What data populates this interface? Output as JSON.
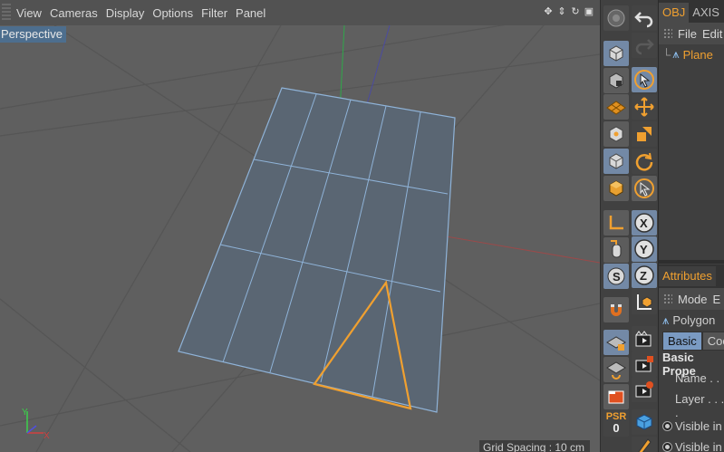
{
  "viewport": {
    "menu": [
      "View",
      "Cameras",
      "Display",
      "Options",
      "Filter",
      "Panel"
    ],
    "view_label": "Perspective",
    "grid_spacing": "Grid Spacing : 10 cm",
    "nav_icons": [
      "move-view-icon",
      "zoom-view-icon",
      "rotate-view-icon",
      "maximize-view-icon"
    ]
  },
  "toolbar_left": {
    "psr_label": "PSR",
    "psr_value": "0"
  },
  "object_manager": {
    "tabs": [
      "OBJ",
      "AXIS"
    ],
    "menu": [
      "File",
      "Edit"
    ],
    "objects": [
      "Plane"
    ]
  },
  "attributes": {
    "tab": "Attributes",
    "menu": [
      "Mode",
      "E"
    ],
    "object_type": "Polygon",
    "buttons": [
      "Basic",
      "Coo"
    ],
    "section": "Basic Prope",
    "fields": [
      "Name . . .",
      "Layer . . . ."
    ],
    "radios": [
      "Visible in",
      "Visible in"
    ]
  },
  "colors": {
    "accent": "#f0a030",
    "selection": "#7389a6",
    "viewport_bg": "#5f5f5f"
  }
}
